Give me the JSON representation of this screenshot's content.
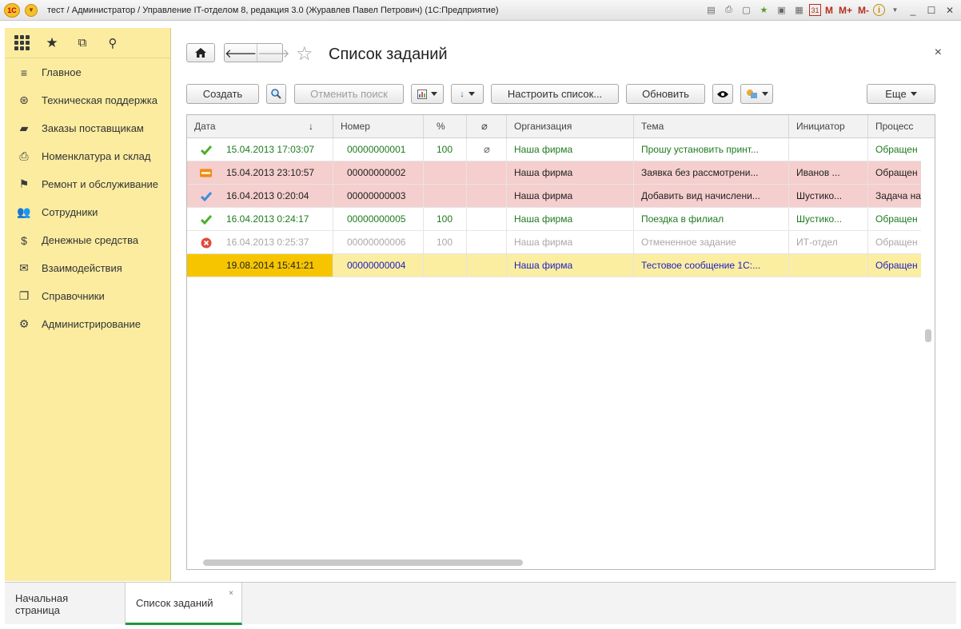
{
  "window": {
    "title": "тест / Администратор / Управление IT-отделом 8, редакция 3.0 (Журавлев Павел Петрович)  (1С:Предприятие)",
    "logo": "1С",
    "tools": [
      "save-icon",
      "print-icon",
      "preview-icon",
      "favorites-icon",
      "calc-icon",
      "calendar-icon"
    ],
    "calendar_day": "31",
    "m_label": "M",
    "mplus_label": "M+",
    "mminus_label": "M-",
    "info_label": "i"
  },
  "sidebar": {
    "items": [
      {
        "label": "Главное",
        "icon": "menu-lines-icon"
      },
      {
        "label": "Техническая поддержка",
        "icon": "lifebuoy-icon"
      },
      {
        "label": "Заказы поставщикам",
        "icon": "truck-icon"
      },
      {
        "label": "Номенклатура и склад",
        "icon": "printer-icon"
      },
      {
        "label": "Ремонт и обслуживание",
        "icon": "checkered-flag-icon"
      },
      {
        "label": "Сотрудники",
        "icon": "people-icon"
      },
      {
        "label": "Денежные средства",
        "icon": "money-bag-icon"
      },
      {
        "label": "Взаимодействия",
        "icon": "envelope-icon"
      },
      {
        "label": "Справочники",
        "icon": "books-icon"
      },
      {
        "label": "Администрирование",
        "icon": "gear-icon"
      }
    ]
  },
  "page": {
    "title": "Список заданий"
  },
  "toolbar": {
    "create": "Создать",
    "cancel_search": "Отменить поиск",
    "configure_list": "Настроить список...",
    "refresh": "Обновить",
    "more": "Еще"
  },
  "table": {
    "columns": [
      "Дата",
      "Номер",
      "%",
      "",
      "Организация",
      "Тема",
      "Инициатор",
      "Процесс"
    ],
    "sort_indicator": "↓",
    "rows": [
      {
        "status": "check-green-icon",
        "date": "15.04.2013 17:03:07",
        "number": "00000000001",
        "percent": "100",
        "attach": true,
        "org": "Наша фирма",
        "topic": "Прошу установить принт...",
        "initiator": "",
        "process": "Обращен",
        "style": "green"
      },
      {
        "status": "new-badge-icon",
        "date": "15.04.2013 23:10:57",
        "number": "00000000002",
        "percent": "",
        "attach": false,
        "org": "Наша фирма",
        "topic": "Заявка без рассмотрени...",
        "initiator": "Иванов ...",
        "process": "Обращен",
        "style": "overdue"
      },
      {
        "status": "check-blue-icon",
        "date": "16.04.2013 0:20:04",
        "number": "00000000003",
        "percent": "",
        "attach": false,
        "org": "Наша фирма",
        "topic": "Добавить вид начислени...",
        "initiator": "Шустико...",
        "process": "Задача на",
        "style": "overdue"
      },
      {
        "status": "check-green-icon",
        "date": "16.04.2013 0:24:17",
        "number": "00000000005",
        "percent": "100",
        "attach": false,
        "org": "Наша фирма",
        "topic": "Поездка в филиал",
        "initiator": "Шустико...",
        "process": "Обращен",
        "style": "green"
      },
      {
        "status": "cancel-red-icon",
        "date": "16.04.2013 0:25:37",
        "number": "00000000006",
        "percent": "100",
        "attach": false,
        "org": "Наша фирма",
        "topic": "Отмененное задание",
        "initiator": "ИТ-отдел",
        "process": "Обращен",
        "style": "grey"
      },
      {
        "status": "target-icon",
        "date": "19.08.2014 15:41:21",
        "number": "00000000004",
        "percent": "",
        "attach": false,
        "org": "Наша фирма",
        "topic": "Тестовое сообщение 1С:...",
        "initiator": "",
        "process": "Обращен",
        "style": "selected"
      }
    ]
  },
  "tabs": [
    {
      "label": "Начальная страница"
    },
    {
      "label": "Список заданий"
    }
  ],
  "tab_close": "×",
  "close": "×"
}
